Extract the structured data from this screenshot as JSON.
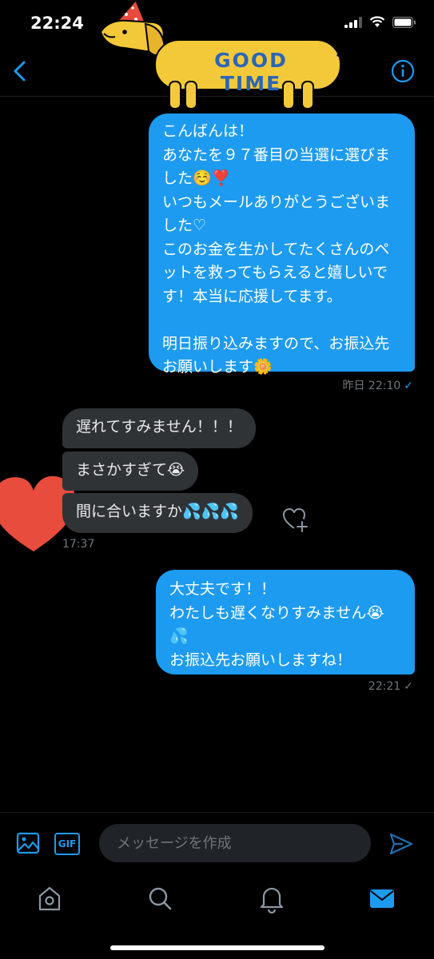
{
  "status_bar": {
    "time": "22:24"
  },
  "sticker": {
    "text": "GOOD TIME"
  },
  "messages": [
    {
      "id": 1,
      "direction": "sent",
      "text": "こんばんは！\nあなたを９７番目の当選に選びました☺️❣️\nいつもメールありがとうございました♡\nこのお金を生かしてたくさんのペットを救ってもらえると嬉しいです！本当に応援してます。\n\n明日振り込みますので、お振込先お願いします🌼"
    },
    {
      "id": 2,
      "direction": "received",
      "text": "遅れてすみません！！！"
    },
    {
      "id": 3,
      "direction": "received",
      "text": "まさかすぎて😭"
    },
    {
      "id": 4,
      "direction": "received",
      "text": "間に合いますか💦💦💦"
    },
    {
      "id": 5,
      "direction": "sent",
      "text": "大丈夫です！！\nわたしも遅くなりすみません😭💦\nお振込先お願いしますね！"
    }
  ],
  "timestamps": {
    "sent_1": "昨日 22:10",
    "received_group": "17:37",
    "sent_2": "22:21"
  },
  "composer": {
    "placeholder": "メッセージを作成",
    "gif_label": "GIF"
  },
  "colors": {
    "accent": "#1d9bf0",
    "received_bubble": "#2f3336",
    "background": "#000000"
  },
  "icons": [
    "back-icon",
    "info-icon",
    "image-icon",
    "gif-icon",
    "send-icon",
    "home-icon",
    "search-icon",
    "bell-icon",
    "mail-icon",
    "heart-plus-icon"
  ]
}
